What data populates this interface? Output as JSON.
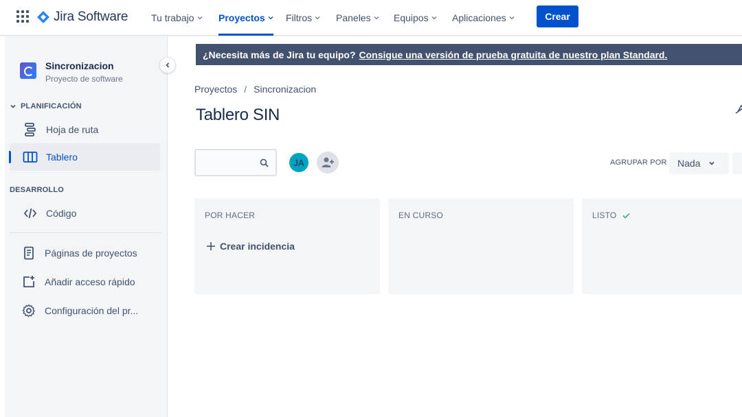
{
  "topnav": {
    "logo_text": "Jira Software",
    "items": [
      {
        "label": "Tu trabajo"
      },
      {
        "label": "Proyectos"
      },
      {
        "label": "Filtros"
      },
      {
        "label": "Paneles"
      },
      {
        "label": "Equipos"
      },
      {
        "label": "Aplicaciones"
      }
    ],
    "create_label": "Crear"
  },
  "sidebar": {
    "project_name": "Sincronizacion",
    "project_type": "Proyecto de software",
    "section_planning": "PLANIFICACIÓN",
    "section_dev": "DESARROLLO",
    "items": [
      {
        "label": "Hoja de ruta"
      },
      {
        "label": "Tablero"
      },
      {
        "label": "Código"
      },
      {
        "label": "Páginas de proyectos"
      },
      {
        "label": "Añadir acceso rápido"
      },
      {
        "label": "Configuración del pr..."
      }
    ]
  },
  "banner": {
    "text": "¿Necesita más de Jira tu equipo?",
    "link": "Consigue una versión de prueba gratuita de nuestro plan Standard."
  },
  "breadcrumb": {
    "root": "Proyectos",
    "sep": "/",
    "current": "Sincronizacion"
  },
  "board": {
    "title": "Tablero SIN",
    "search_placeholder": "",
    "avatar_initials": "JA",
    "group_by_label": "AGRUPAR POR",
    "group_by_value": "Nada",
    "columns": [
      {
        "title": "POR HACER",
        "create_label": "Crear incidencia"
      },
      {
        "title": "EN CURSO"
      },
      {
        "title": "LISTO"
      }
    ]
  },
  "colors": {
    "primary": "#0052cc",
    "banner_bg": "#42526e",
    "sidebar_bg": "#f4f5f7",
    "done_check": "#36b37e"
  }
}
